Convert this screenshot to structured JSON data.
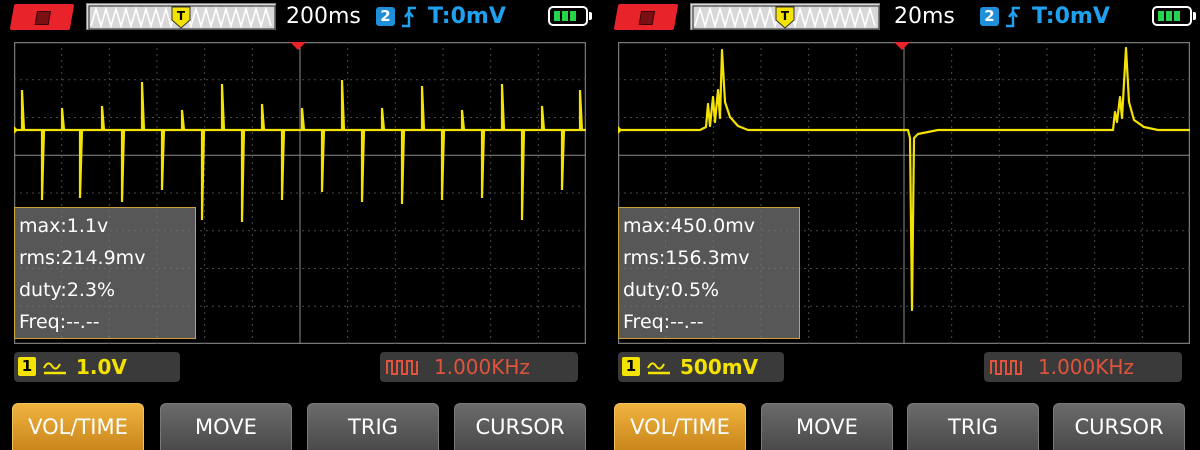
{
  "colors": {
    "trace": "#f4e200",
    "grid": "#4a4a4a",
    "trigger_level": "#1ea2f0",
    "freq_text": "#e0533c",
    "active_button": "#e8a22c",
    "stop_button": "#e8232a",
    "battery_fill": "#27d34b"
  },
  "panels": [
    {
      "top_bar": {
        "run_state_icon": "stop-icon",
        "timebase": "200ms",
        "channel_badge": "2",
        "trigger_edge_icon": "rising-edge-icon",
        "trigger_level": "T:0mV",
        "battery_icon": "battery-icon",
        "battery_bars": 3
      },
      "measurements": {
        "max": "max:1.1v",
        "rms": "rms:214.9mv",
        "duty": "duty:2.3%",
        "freq": "Freq:--.--"
      },
      "channel": {
        "number": "1",
        "coupling_icon": "dc-coupling-icon",
        "volts_per_div": "1.0V"
      },
      "frequency": {
        "icon": "square-wave-icon",
        "value": "1.000KHz"
      },
      "buttons": [
        {
          "label": "VOL/TIME",
          "active": true
        },
        {
          "label": "MOVE",
          "active": false
        },
        {
          "label": "TRIG",
          "active": false
        },
        {
          "label": "CURSOR",
          "active": false
        }
      ]
    },
    {
      "top_bar": {
        "run_state_icon": "stop-icon",
        "timebase": "20ms",
        "channel_badge": "2",
        "trigger_edge_icon": "rising-edge-icon",
        "trigger_level": "T:0mV",
        "battery_icon": "battery-icon",
        "battery_bars": 3
      },
      "measurements": {
        "max": "max:450.0mv",
        "rms": "rms:156.3mv",
        "duty": "duty:0.5%",
        "freq": "Freq:--.--"
      },
      "channel": {
        "number": "1",
        "coupling_icon": "dc-coupling-icon",
        "volts_per_div": "500mV"
      },
      "frequency": {
        "icon": "square-wave-icon",
        "value": "1.000KHz"
      },
      "buttons": [
        {
          "label": "VOL/TIME",
          "active": true
        },
        {
          "label": "MOVE",
          "active": false
        },
        {
          "label": "TRIG",
          "active": false
        },
        {
          "label": "CURSOR",
          "active": false
        }
      ]
    }
  ]
}
